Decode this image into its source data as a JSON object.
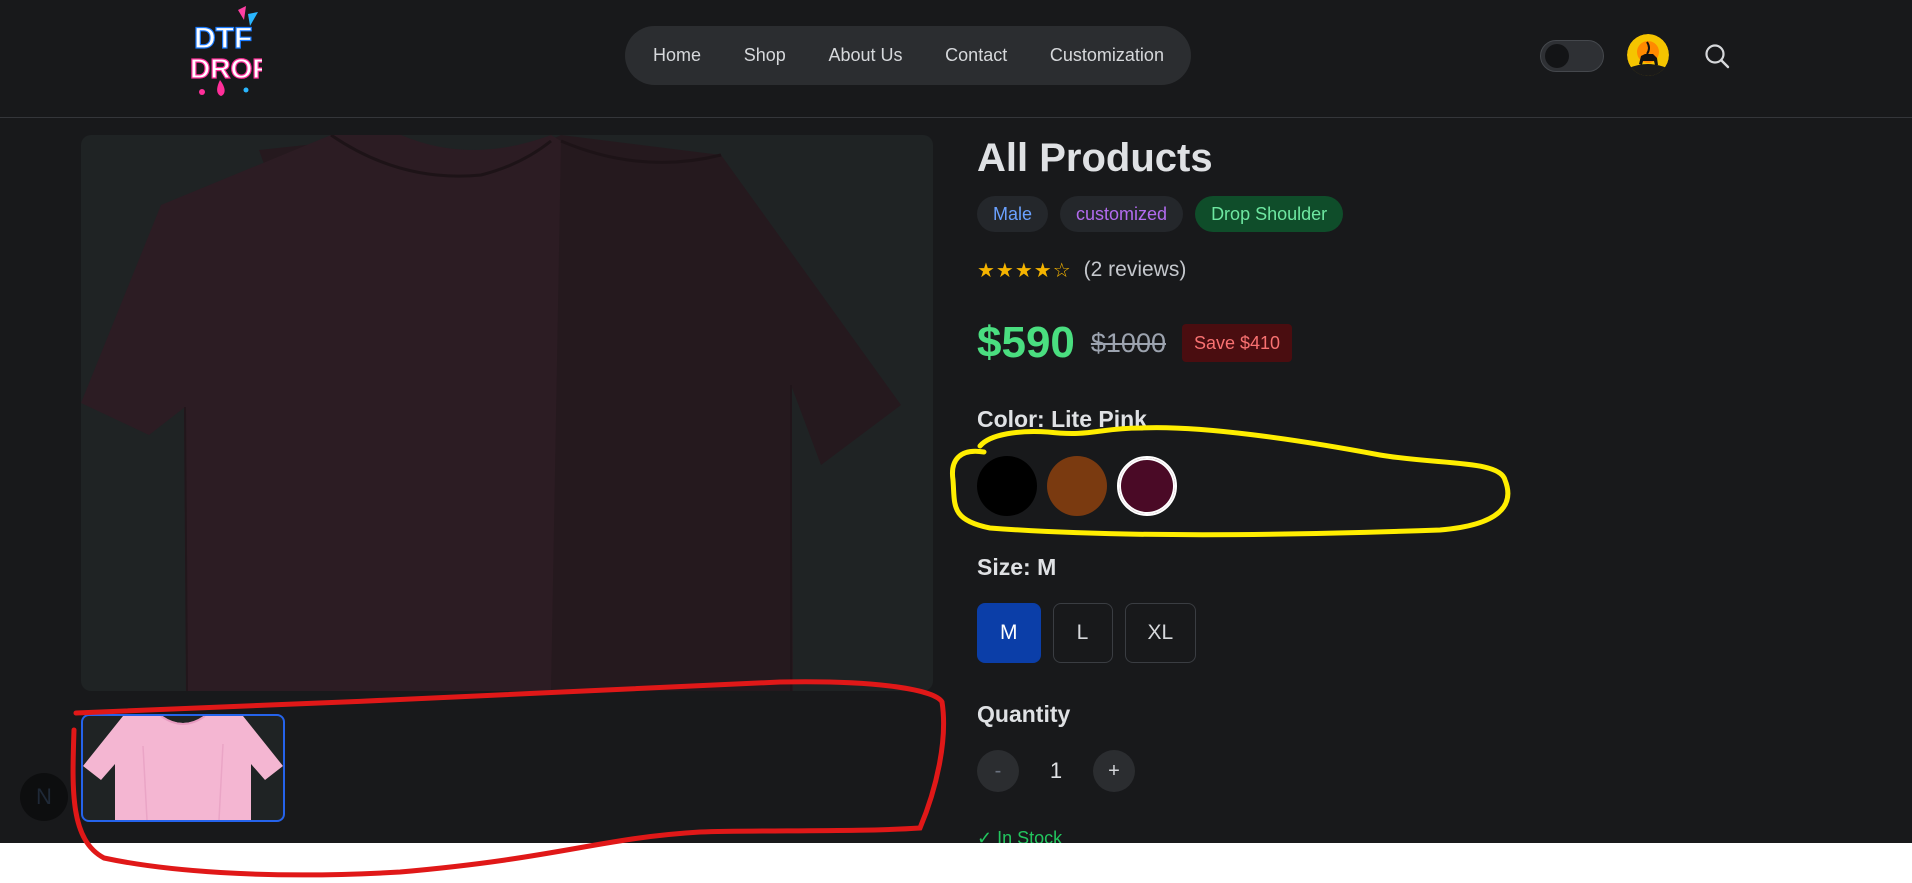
{
  "header": {
    "logo_text_top": "DTF",
    "logo_text_bottom": "DROP",
    "nav": [
      {
        "label": "Home"
      },
      {
        "label": "Shop"
      },
      {
        "label": "About Us"
      },
      {
        "label": "Contact"
      },
      {
        "label": "Customization"
      }
    ],
    "theme_toggle_on": false
  },
  "product": {
    "title": "All Products",
    "tags": [
      "Male",
      "customized",
      "Drop Shoulder"
    ],
    "stars": "★★★★☆",
    "rating_value": 4,
    "reviews": "(2 reviews)",
    "price": "$590",
    "old_price": "$1000",
    "save": "Save $410",
    "color_label": "Color: Lite Pink",
    "colors": [
      {
        "name": "Black",
        "hex": "#000000"
      },
      {
        "name": "Brown",
        "hex": "#7a3a10"
      },
      {
        "name": "Maroon",
        "hex": "#4a0a26",
        "selected": true
      }
    ],
    "size_label": "Size: M",
    "sizes": [
      "M",
      "L",
      "XL"
    ],
    "selected_size": "M",
    "quantity_label": "Quantity",
    "qty_minus": "-",
    "qty_value": "1",
    "qty_plus": "+",
    "stock": "✓ In Stock"
  },
  "gallery": {
    "main_color": "#2a1c22",
    "thumb_color": "#f4b6d2"
  },
  "fab_label": "N",
  "annotations": {
    "yellow": "#ffee00",
    "red": "#e01818"
  }
}
